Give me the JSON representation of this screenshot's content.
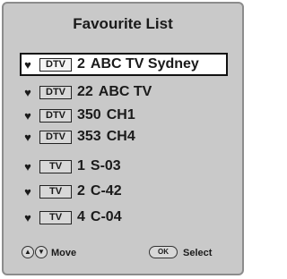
{
  "title": "Favourite List",
  "channels": [
    {
      "type": "DTV",
      "number": "2",
      "name": "ABC TV Sydney",
      "selected": true
    },
    {
      "type": "DTV",
      "number": "22",
      "name": "ABC TV",
      "selected": false
    },
    {
      "type": "DTV",
      "number": "350",
      "name": "CH1",
      "selected": false
    },
    {
      "type": "DTV",
      "number": "353",
      "name": "CH4",
      "selected": false
    },
    {
      "type": "TV",
      "number": "1",
      "name": "S-03",
      "selected": false
    },
    {
      "type": "TV",
      "number": "2",
      "name": "C-42",
      "selected": false
    },
    {
      "type": "TV",
      "number": "4",
      "name": "C-04",
      "selected": false
    }
  ],
  "footer": {
    "move_label": "Move",
    "ok_label": "OK",
    "select_label": "Select"
  },
  "icons": {
    "favourite": "heart-icon",
    "move": "up-down-arrows-icon"
  }
}
